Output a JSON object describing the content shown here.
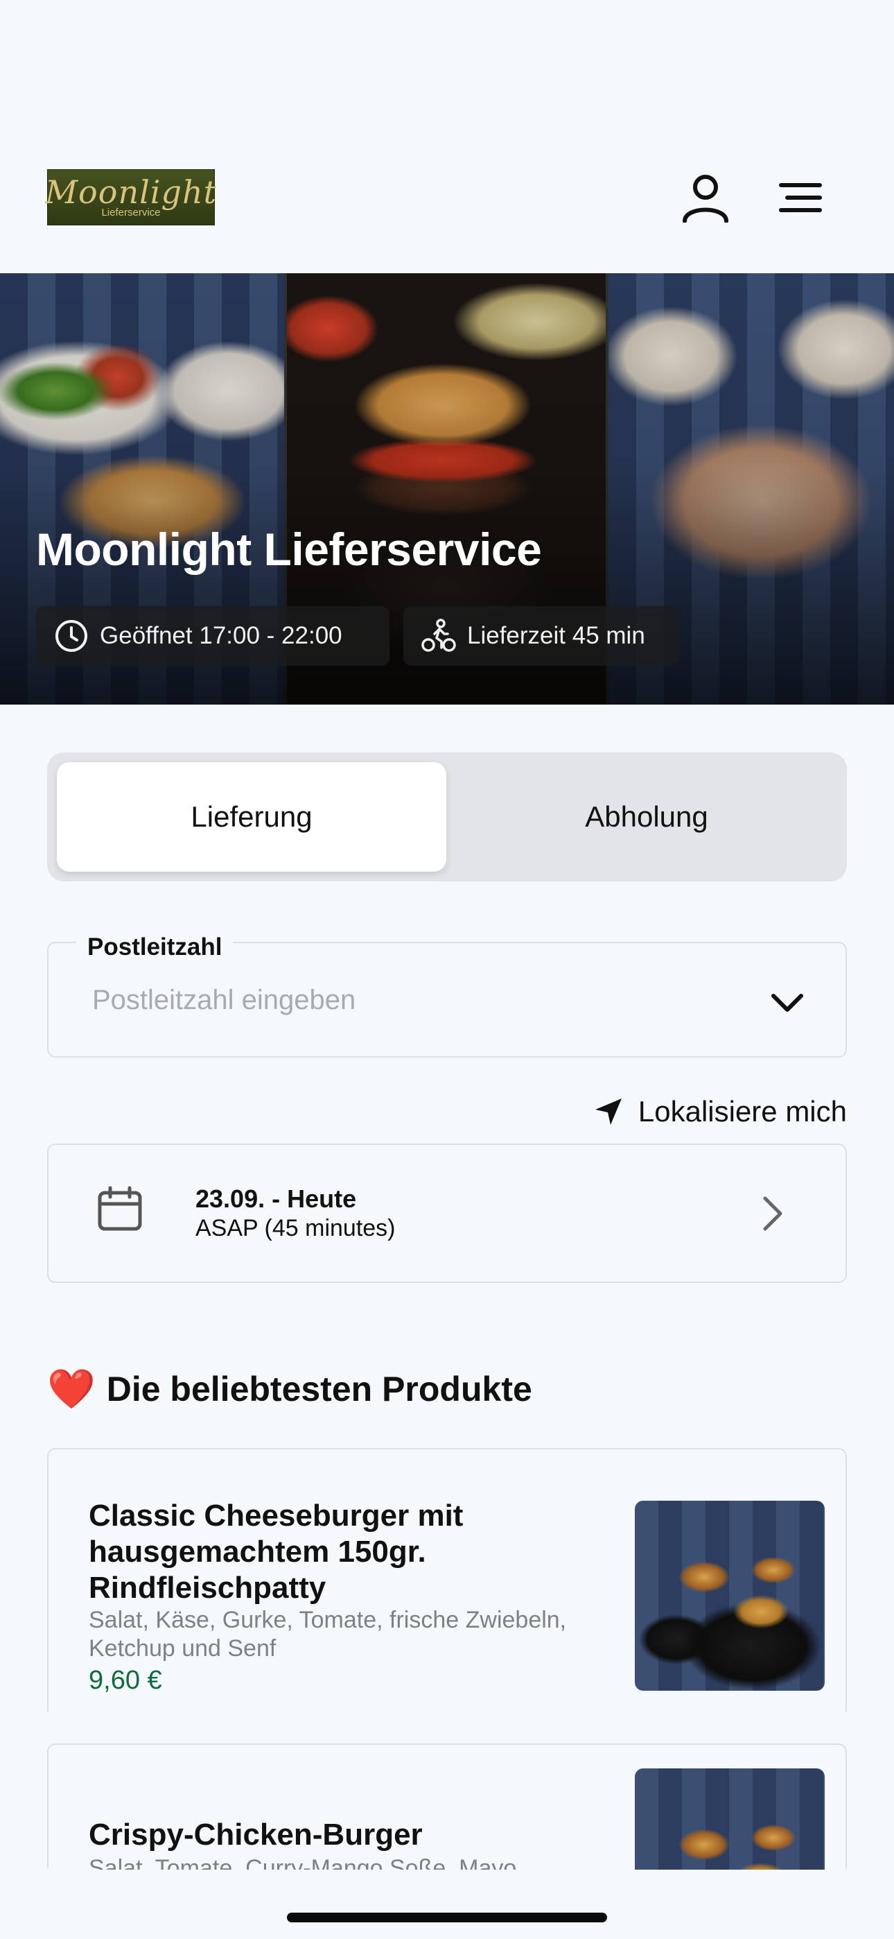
{
  "header": {
    "logo_text": "Moonlight",
    "logo_subtext": "Lieferservice",
    "account_icon": "user-icon",
    "menu_icon": "menu-icon"
  },
  "hero": {
    "title": "Moonlight Lieferservice",
    "opening_hours": "Geöffnet 17:00 - 22:00",
    "opening_icon": "clock-icon",
    "delivery_time": "Lieferzeit 45 min",
    "delivery_icon": "bicycle-courier-icon"
  },
  "order_mode": {
    "options": [
      "Lieferung",
      "Abholung"
    ],
    "selected": "Lieferung"
  },
  "postcode": {
    "label": "Postleitzahl",
    "placeholder": "Postleitzahl eingeben",
    "value": ""
  },
  "locate": {
    "label": "Lokalisiere mich",
    "icon": "location-arrow-icon"
  },
  "schedule": {
    "date": "23.09. - Heute",
    "time": "ASAP (45 minutes)",
    "icon": "calendar-icon"
  },
  "popular": {
    "emoji": "❤️",
    "title": "Die beliebtesten Produkte",
    "products": [
      {
        "name": "Classic Cheeseburger mit hausgemachtem 150gr. Rindfleischpatty",
        "description": "Salat, Käse, Gurke, Tomate, frische Zwiebeln, Ketchup und Senf",
        "price": "9,60 €"
      },
      {
        "name": "Crispy-Chicken-Burger",
        "description": "Salat, Tomate, Curry-Mango Soße, Mayo"
      }
    ]
  },
  "colors": {
    "background": "#f6f9fc",
    "price_green": "#0d6b3c",
    "border": "#dcdfe3",
    "segment_bg": "#e2e4e7"
  }
}
